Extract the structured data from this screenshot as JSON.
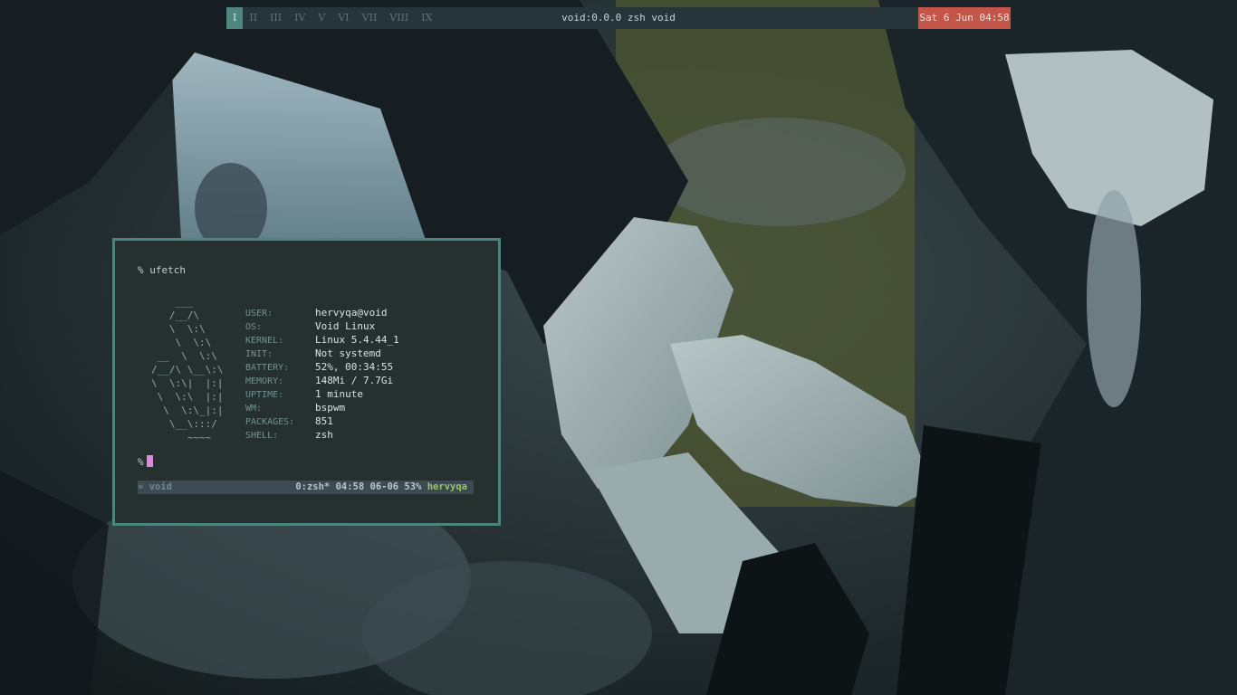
{
  "topbar": {
    "workspaces": [
      "I",
      "II",
      "III",
      "IV",
      "V",
      "VI",
      "VII",
      "VIII",
      "IX"
    ],
    "active_workspace": "I",
    "window_title": "void:0.0.0 zsh void",
    "clock": "Sat 6 Jun 04:58"
  },
  "terminal": {
    "prompt_line": "% ufetch",
    "ascii_logo": "    ___\n   /__/\\\n   \\  \\:\\\n    \\  \\:\\\n __  \\  \\:\\\n/__/\\ \\__\\:\\\n\\  \\:\\|  |:|\n \\  \\:\\  |:|\n  \\  \\:\\_|:|\n   \\__\\:::/\n      ~~~~",
    "info": [
      {
        "key": "USER:",
        "value": "hervyqa@void"
      },
      {
        "key": "OS:",
        "value": "Void Linux"
      },
      {
        "key": "KERNEL:",
        "value": "Linux 5.4.44_1"
      },
      {
        "key": "INIT:",
        "value": "Not systemd"
      },
      {
        "key": "BATTERY:",
        "value": "52%, 00:34:55"
      },
      {
        "key": "MEMORY:",
        "value": "148Mi / 7.7Gi"
      },
      {
        "key": "UPTIME:",
        "value": "1 minute"
      },
      {
        "key": "WM:",
        "value": "bspwm"
      },
      {
        "key": "PACKAGES:",
        "value": "851"
      },
      {
        "key": "SHELL:",
        "value": "zsh"
      }
    ],
    "prompt_empty": "%",
    "tmux": {
      "left": "» void",
      "right": "0:zsh* 04:58 06-06 53%",
      "user": "hervyqa"
    }
  },
  "colors": {
    "bar_bg": "#27343a",
    "active_workspace": "#4f8780",
    "clock_bg": "#c4554a",
    "terminal_bg": "#25302f",
    "terminal_border": "#4d857e",
    "cursor": "#d48fd6",
    "tmux_user": "#97c26a"
  }
}
